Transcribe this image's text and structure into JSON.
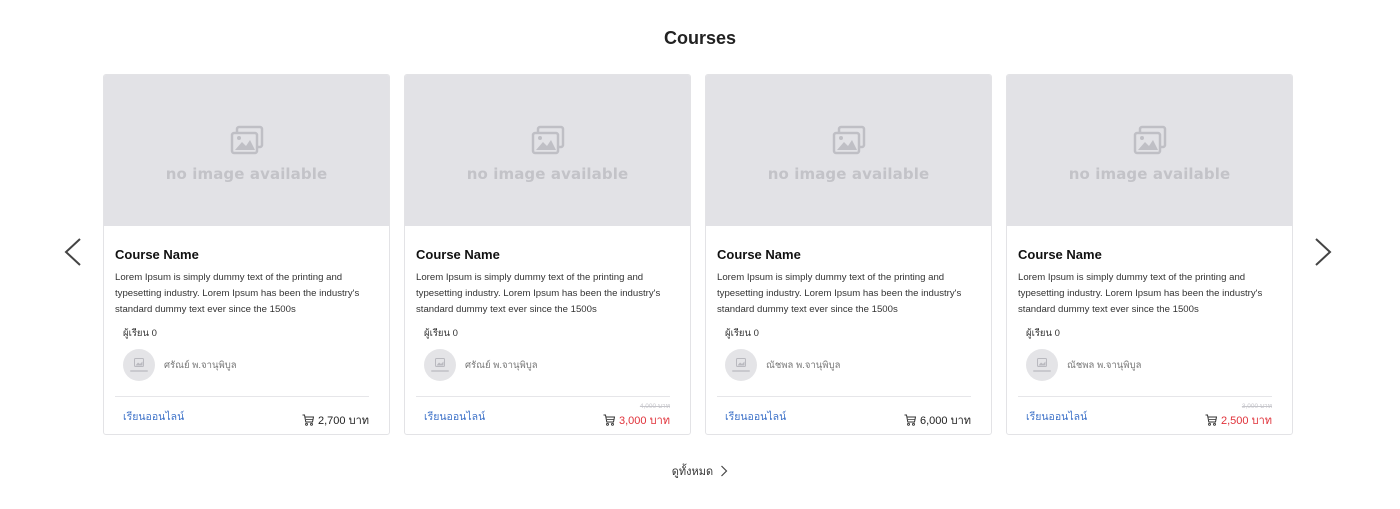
{
  "section": {
    "title": "Courses"
  },
  "nav": {
    "prev_icon": "chevron-left-icon",
    "next_icon": "chevron-right-icon"
  },
  "placeholder": {
    "text": "no image available",
    "icon": "image-icon"
  },
  "courses": [
    {
      "name": "Course Name",
      "description": "Lorem Ipsum is simply dummy text of the printing and typesetting industry. Lorem Ipsum has been the industry's standard dummy text ever since the 1500s",
      "students": "ผู้เรียน 0",
      "instructor": "ศรัณย์ พ.จานุพิบูล",
      "learn_label": "เรียนออนไลน์",
      "old_price": "",
      "price": "2,700 บาท",
      "on_sale": false
    },
    {
      "name": "Course Name",
      "description": "Lorem Ipsum is simply dummy text of the printing and typesetting industry. Lorem Ipsum has been the industry's standard dummy text ever since the 1500s",
      "students": "ผู้เรียน 0",
      "instructor": "ศรัณย์ พ.จานุพิบูล",
      "learn_label": "เรียนออนไลน์",
      "old_price": "4,000 บาท",
      "price": "3,000 บาท",
      "on_sale": true
    },
    {
      "name": "Course Name",
      "description": "Lorem Ipsum is simply dummy text of the printing and typesetting industry. Lorem Ipsum has been the industry's standard dummy text ever since the 1500s",
      "students": "ผู้เรียน 0",
      "instructor": "ณัชพล พ.จานุพิบูล",
      "learn_label": "เรียนออนไลน์",
      "old_price": "",
      "price": "6,000 บาท",
      "on_sale": false
    },
    {
      "name": "Course Name",
      "description": "Lorem Ipsum is simply dummy text of the printing and typesetting industry. Lorem Ipsum has been the industry's standard dummy text ever since the 1500s",
      "students": "ผู้เรียน 0",
      "instructor": "ณัชพล พ.จานุพิบูล",
      "learn_label": "เรียนออนไลน์",
      "old_price": "3,000 บาท",
      "price": "2,500 บาท",
      "on_sale": true
    }
  ],
  "footer": {
    "view_all_label": "ดูทั้งหมด",
    "view_all_icon": "chevron-right-icon"
  },
  "colors": {
    "link": "#3f73c9",
    "sale": "#e0323a",
    "placeholder_bg": "#e2e2e6"
  }
}
